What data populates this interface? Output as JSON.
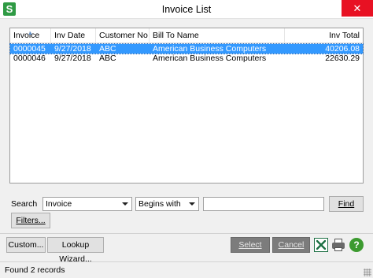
{
  "window": {
    "title": "Invoice List",
    "app_icon_glyph": "S",
    "close_glyph": "✕"
  },
  "grid": {
    "columns": [
      "Invoice",
      "Inv Date",
      "Customer No",
      "Bill To Name",
      "Inv Total"
    ],
    "sort_indicator": "▲",
    "rows": [
      {
        "invoice": "0000045",
        "date": "9/27/2018",
        "customer": "ABC",
        "bill_to": "American Business Computers",
        "total": "40206.08",
        "selected": true
      },
      {
        "invoice": "0000046",
        "date": "9/27/2018",
        "customer": "ABC",
        "bill_to": "American Business Computers",
        "total": "22630.29",
        "selected": false
      }
    ]
  },
  "search": {
    "label": "Search",
    "field_value": "Invoice",
    "operator_value": "Begins with",
    "text_value": "",
    "find_label": "Find",
    "filters_label": "Filters..."
  },
  "toolbar": {
    "custom_label": "Custom...",
    "lookup_wizard_label": "Lookup Wizard...",
    "select_label": "Select",
    "cancel_label": "Cancel",
    "help_glyph": "?"
  },
  "icons": [
    "excel-icon",
    "printer-icon",
    "help-icon"
  ],
  "status": {
    "text": "Found 2 records"
  },
  "colors": {
    "selection": "#3399ff",
    "close": "#e81123",
    "app_icon": "#2f9a44"
  }
}
